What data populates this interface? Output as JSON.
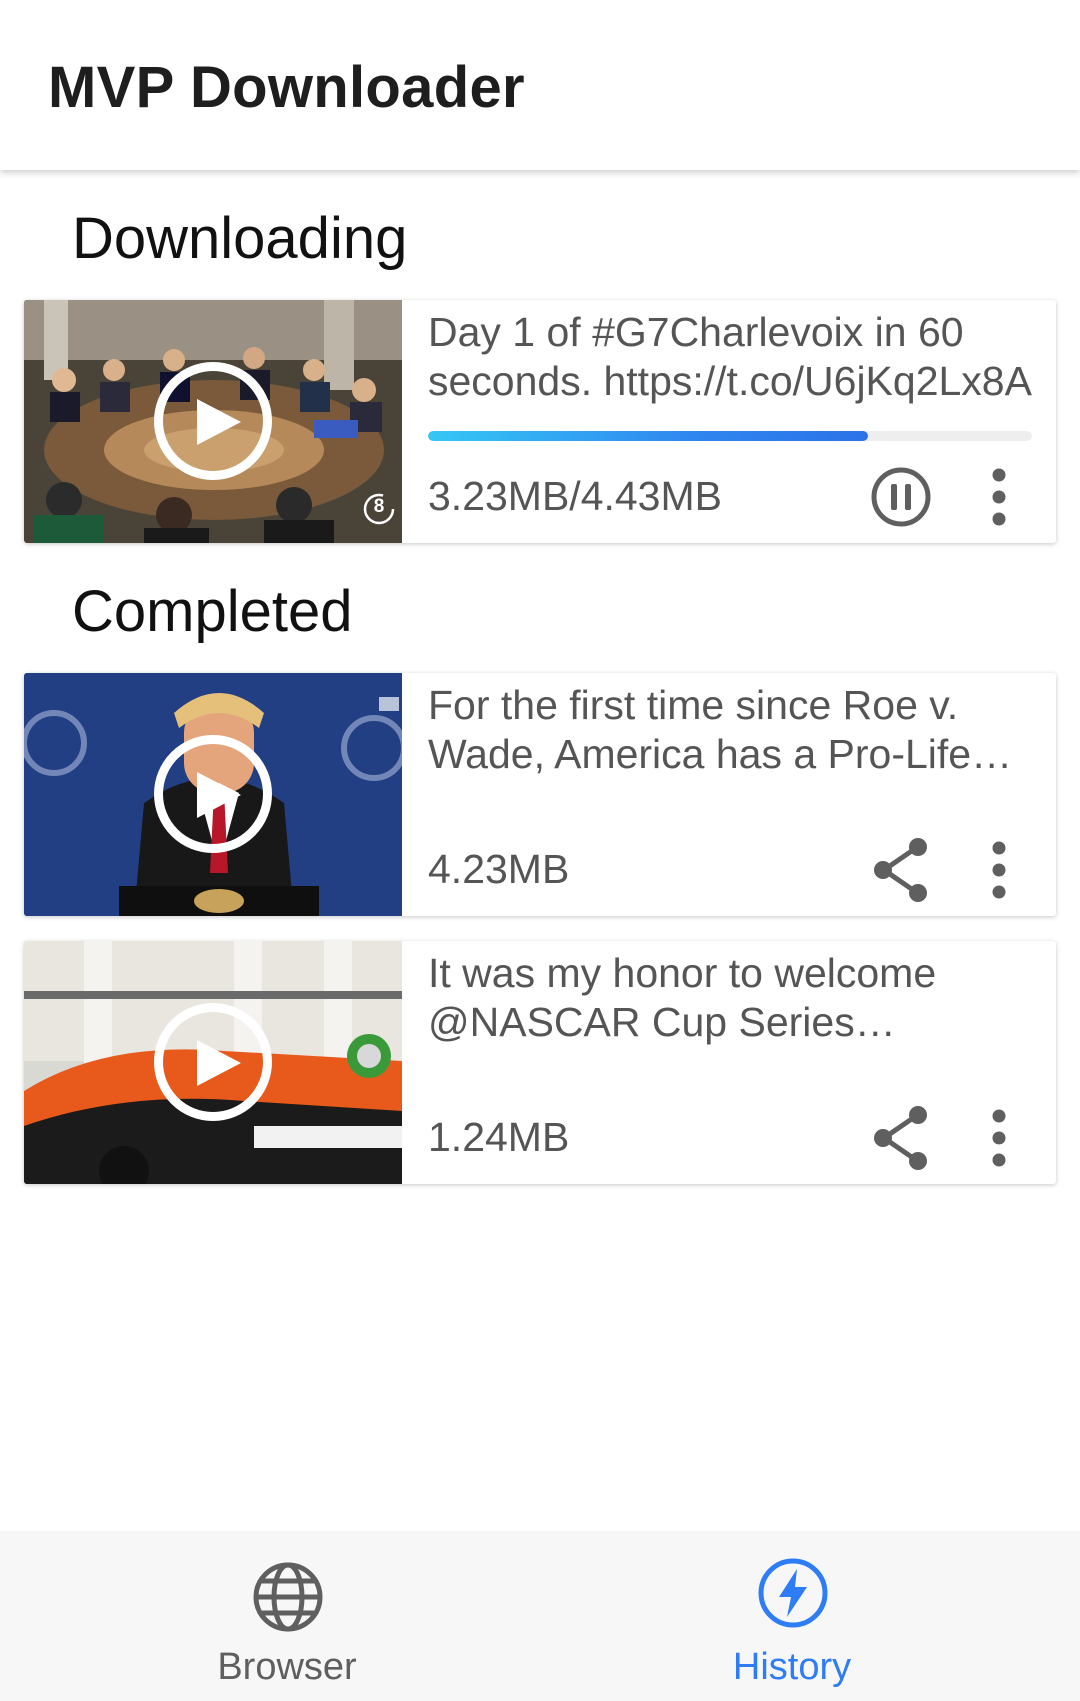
{
  "app": {
    "title": "MVP Downloader"
  },
  "sections": {
    "downloading": "Downloading",
    "completed": "Completed"
  },
  "downloading": [
    {
      "title": "Day 1 of #G7Charlevoix in 60 seconds. https://t.co/U6jKq2Lx8A",
      "size": "3.23MB/4.43MB",
      "progress": 0.729,
      "thumb_badge": "8",
      "action_icon": "pause-circle-icon",
      "menu_icon": "more-vert-icon"
    }
  ],
  "completed": [
    {
      "title": "For the first time since Roe v. Wade, America has a Pro-Life President",
      "size": "4.23MB",
      "action_icon": "share-icon",
      "menu_icon": "more-vert-icon"
    },
    {
      "title": "It was my honor to welcome @NASCAR Cup Series Champion",
      "size": "1.24MB",
      "action_icon": "share-icon",
      "menu_icon": "more-vert-icon"
    }
  ],
  "bottom_nav": {
    "items": [
      {
        "label": "Browser",
        "icon": "globe-icon",
        "active": false
      },
      {
        "label": "History",
        "icon": "bolt-icon",
        "active": true
      }
    ]
  },
  "colors": {
    "accent": "#2e7cf6",
    "progress_start": "#35c7f4",
    "progress_end": "#2b72e8",
    "inactive_icon": "#5f5f5f",
    "text_secondary": "#555555"
  }
}
